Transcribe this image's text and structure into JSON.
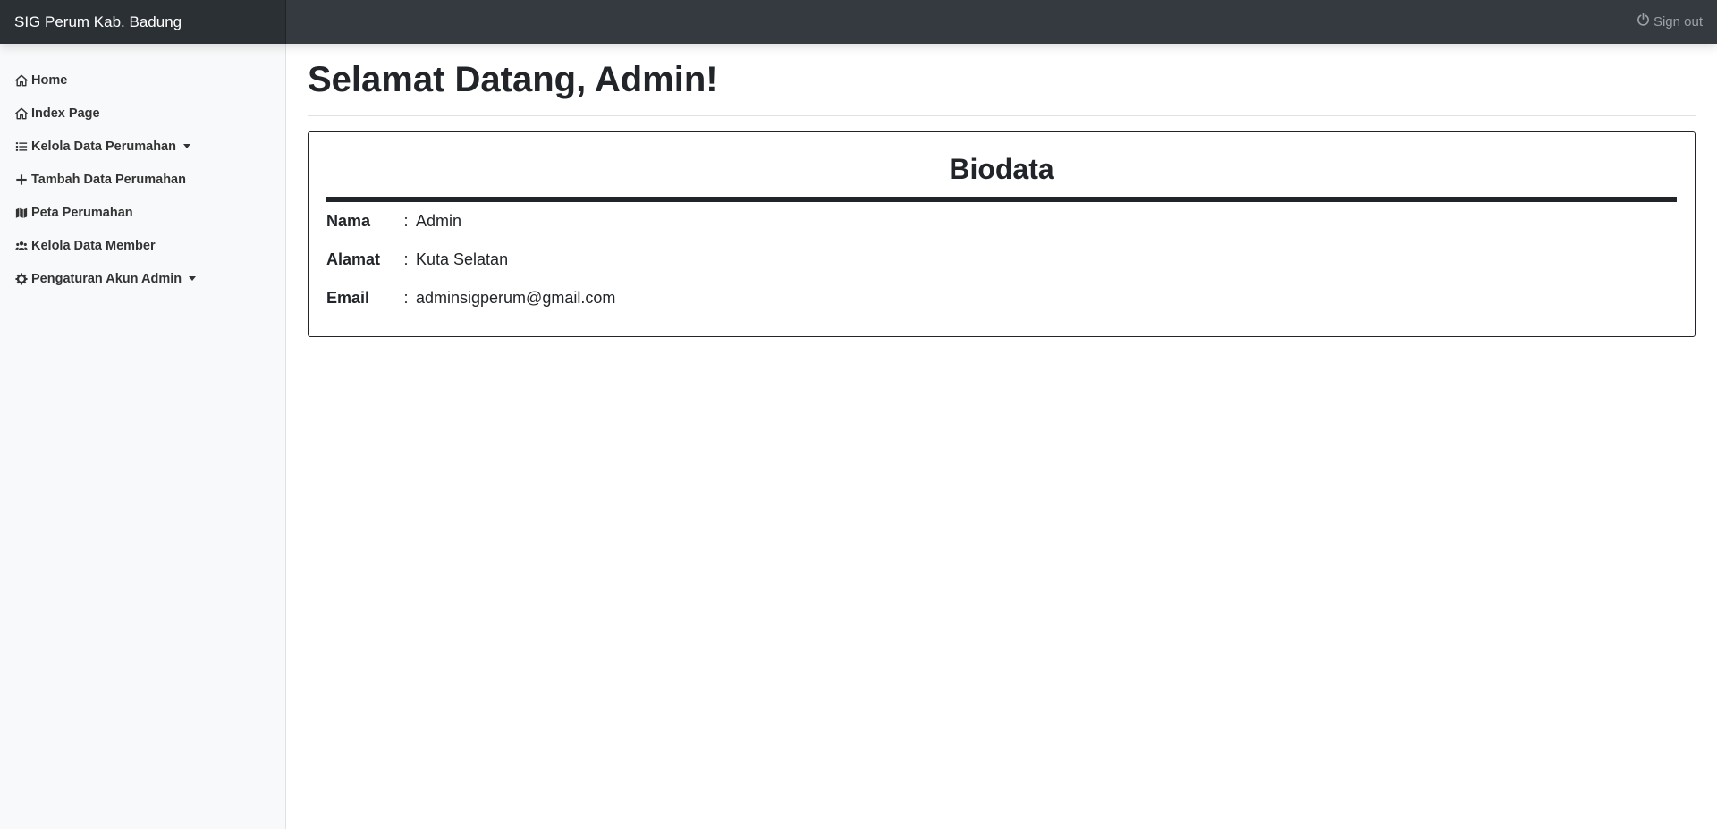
{
  "app": {
    "brand": "SIG Perum Kab. Badung",
    "signout_label": "Sign out"
  },
  "sidebar": {
    "items": [
      {
        "label": "Home",
        "icon": "home-icon"
      },
      {
        "label": "Index Page",
        "icon": "home-icon"
      },
      {
        "label": "Kelola Data Perumahan",
        "icon": "list-icon",
        "dropdown": true
      },
      {
        "label": "Tambah Data Perumahan",
        "icon": "plus-icon"
      },
      {
        "label": "Peta Perumahan",
        "icon": "map-icon"
      },
      {
        "label": "Kelola Data Member",
        "icon": "users-icon"
      },
      {
        "label": "Pengaturan Akun Admin",
        "icon": "gear-icon",
        "dropdown": true
      }
    ]
  },
  "main": {
    "title": "Selamat Datang, Admin!",
    "card": {
      "title": "Biodata",
      "rows": [
        {
          "label": "Nama",
          "sep": ":",
          "value": "Admin"
        },
        {
          "label": "Alamat",
          "sep": ":",
          "value": "Kuta Selatan"
        },
        {
          "label": "Email",
          "sep": ":",
          "value": "adminsigperum@gmail.com"
        }
      ]
    }
  },
  "colors": {
    "navbar": "#343a40",
    "brand_bg": "#2b3035",
    "sidebar_bg": "#f8f9fa",
    "text": "#212529"
  }
}
